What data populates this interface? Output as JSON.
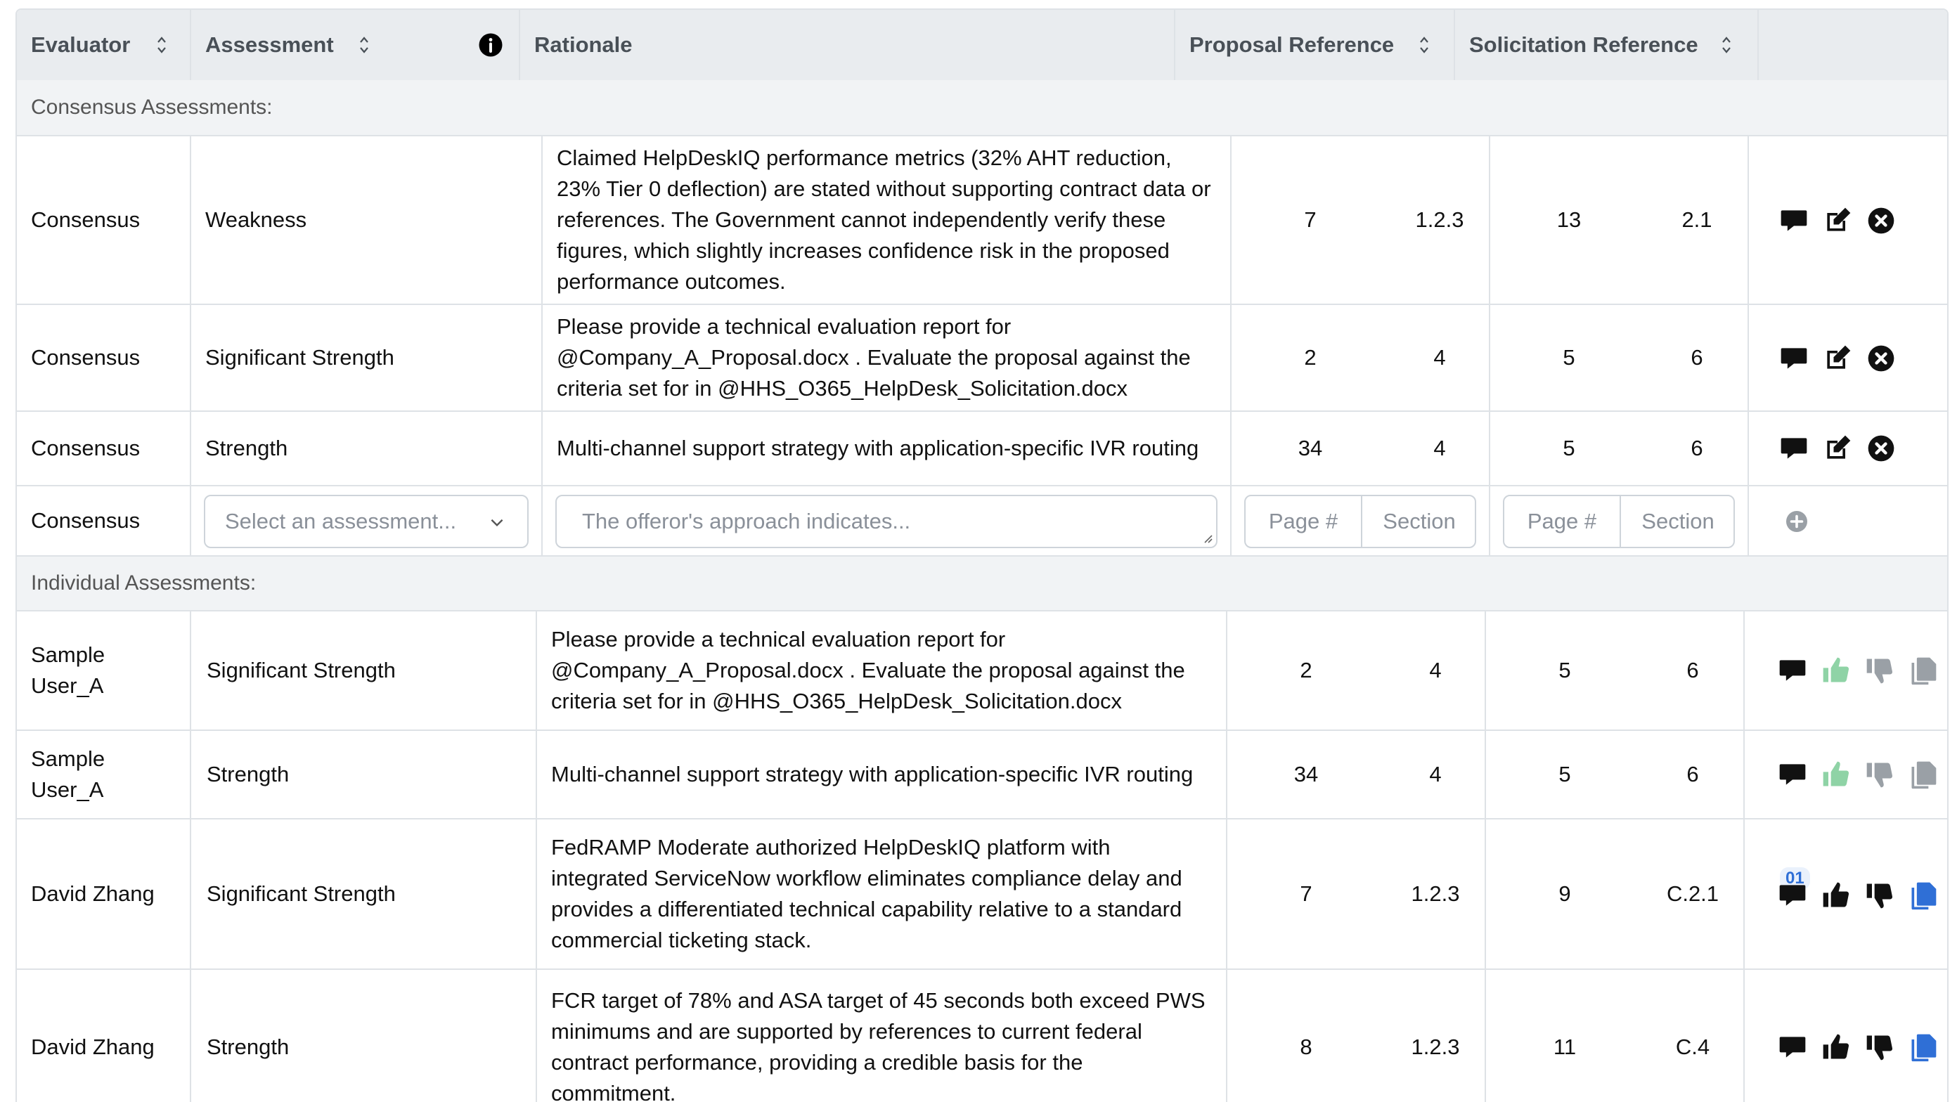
{
  "header": {
    "evaluator": "Evaluator",
    "assessment": "Assessment",
    "rationale": "Rationale",
    "proposal_ref": "Proposal Reference",
    "solicitation_ref": "Solicitation Reference"
  },
  "sections": {
    "consensus": "Consensus Assessments:",
    "individual": "Individual Assessments:"
  },
  "consensus_rows": [
    {
      "evaluator": "Consensus",
      "assessment": "Weakness",
      "rationale": "Claimed HelpDeskIQ performance metrics (32% AHT reduction, 23% Tier 0 deflection) are stated without supporting contract data or references. The Government cannot independently verify these figures, which slightly increases confidence risk in the proposed performance outcomes.",
      "prop_page": "7",
      "prop_section": "1.2.3",
      "sol_page": "13",
      "sol_section": "2.1"
    },
    {
      "evaluator": "Consensus",
      "assessment": "Significant Strength",
      "rationale": "Please provide a technical evaluation report for @Company_A_Proposal.docx . Evaluate the proposal against the criteria set for in @HHS_O365_HelpDesk_Solicitation.docx",
      "prop_page": "2",
      "prop_section": "4",
      "sol_page": "5",
      "sol_section": "6"
    },
    {
      "evaluator": "Consensus",
      "assessment": "Strength",
      "rationale": "Multi-channel support strategy with application-specific IVR routing",
      "prop_page": "34",
      "prop_section": "4",
      "sol_page": "5",
      "sol_section": "6"
    }
  ],
  "new_row": {
    "evaluator": "Consensus",
    "assessment_placeholder": "Select an assessment...",
    "rationale_placeholder": "The offeror's approach indicates...",
    "page_placeholder": "Page #",
    "section_placeholder": "Section"
  },
  "individual_rows": [
    {
      "evaluator": "Sample User_A",
      "assessment": "Significant Strength",
      "rationale": "Please provide a technical evaluation report for @Company_A_Proposal.docx . Evaluate the proposal against the criteria set for in @HHS_O365_HelpDesk_Solicitation.docx",
      "prop_page": "2",
      "prop_section": "4",
      "sol_page": "5",
      "sol_section": "6"
    },
    {
      "evaluator": "Sample User_A",
      "assessment": "Strength",
      "rationale": "Multi-channel support strategy with application-specific IVR routing",
      "prop_page": "34",
      "prop_section": "4",
      "sol_page": "5",
      "sol_section": "6"
    },
    {
      "evaluator": "David Zhang",
      "assessment": "Significant Strength",
      "rationale": "FedRAMP Moderate authorized HelpDeskIQ platform with integrated ServiceNow workflow eliminates compliance delay and provides a differentiated technical capability relative to a standard commercial ticketing stack.",
      "prop_page": "7",
      "prop_section": "1.2.3",
      "sol_page": "9",
      "sol_section": "C.2.1",
      "comment_badge": "01"
    },
    {
      "evaluator": "David Zhang",
      "assessment": "Strength",
      "rationale": "FCR target of 78% and ASA target of 45 seconds both exceed PWS minimums and are supported by references to current federal contract performance, providing a credible basis for the commitment.",
      "prop_page": "8",
      "prop_section": "1.2.3",
      "sol_page": "11",
      "sol_section": "C.4"
    }
  ],
  "colors": {
    "header_bg": "#e9ecef",
    "section_bg": "#f1f3f5",
    "border": "#dee2e6",
    "accent_blue": "#2f6fd6",
    "muted_green": "#8fd3a6",
    "muted_gray": "#9aa0a6"
  },
  "icons": [
    "sort-icon",
    "info-icon",
    "comment-icon",
    "edit-icon",
    "delete-icon",
    "add-icon",
    "thumbs-up-icon",
    "thumbs-down-icon",
    "copy-icon",
    "chevron-down-icon"
  ]
}
